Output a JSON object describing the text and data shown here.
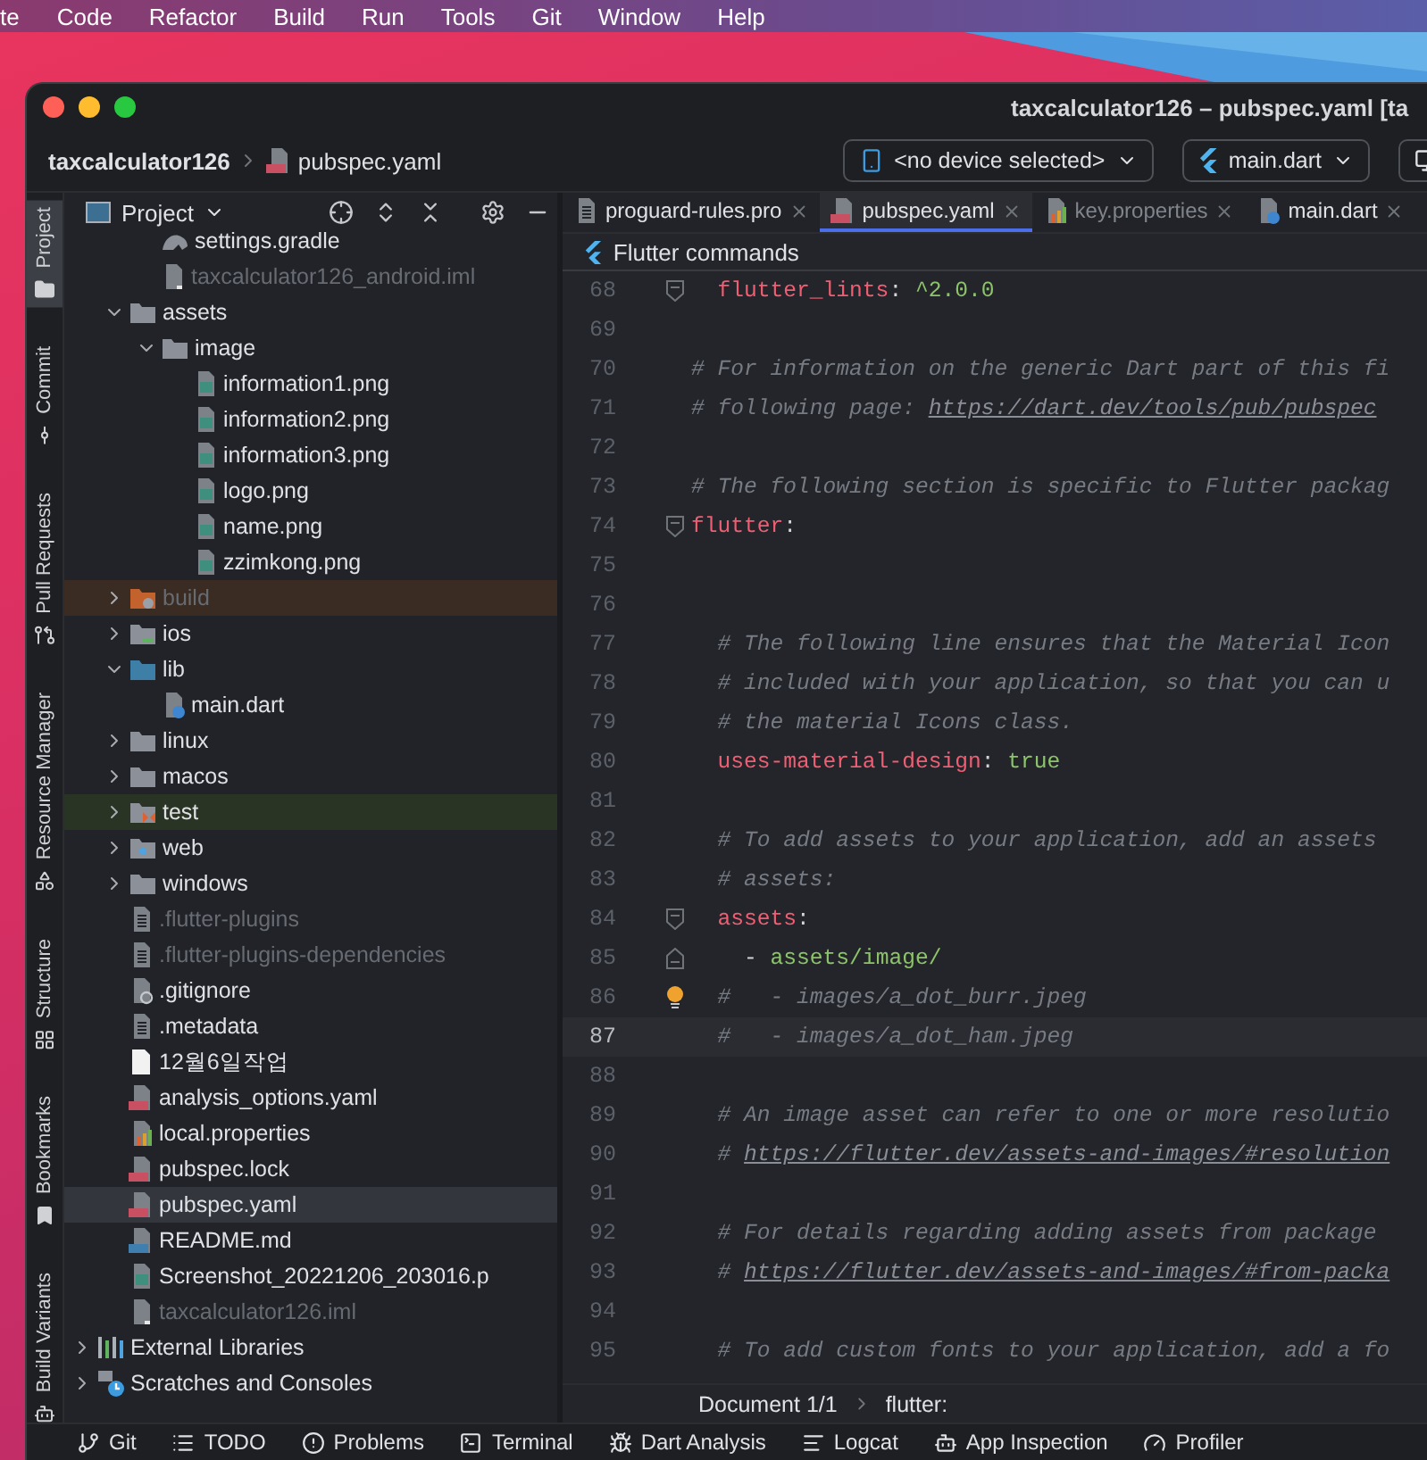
{
  "menu_bar": {
    "items": [
      "te",
      "Code",
      "Refactor",
      "Build",
      "Run",
      "Tools",
      "Git",
      "Window",
      "Help"
    ]
  },
  "window": {
    "title": "taxcalculator126 – pubspec.yaml [ta"
  },
  "breadcrumb": {
    "project": "taxcalculator126",
    "file": "pubspec.yaml"
  },
  "toolbar": {
    "device": "<no device selected>",
    "run_config": "main.dart"
  },
  "tool_strip": [
    {
      "label": "Project",
      "kind": "folder",
      "selected": true
    },
    {
      "label": "Commit",
      "kind": "commit",
      "selected": false
    },
    {
      "label": "Pull Requests",
      "kind": "pull",
      "selected": false
    },
    {
      "label": "Resource Manager",
      "kind": "resources",
      "selected": false
    },
    {
      "label": "Structure",
      "kind": "structure",
      "selected": false
    },
    {
      "label": "Bookmarks",
      "kind": "bookmark",
      "selected": false
    },
    {
      "label": "Build Variants",
      "kind": "android",
      "selected": false
    }
  ],
  "project_panel": {
    "title": "Project",
    "tree": [
      {
        "children": [
          {
            "children": [
              {
                "label": "settings.gradle",
                "kind": "gradle",
                "dimmed": false,
                "selected": false
              },
              {
                "label": "taxcalculator126_android.iml",
                "kind": "iml",
                "dimmed": true,
                "selected": false
              }
            ]
          },
          {
            "label": "assets",
            "kind": "folder",
            "expanded": true,
            "dimmed": false,
            "selected": false,
            "children": [
              {
                "label": "image",
                "kind": "folder",
                "expanded": true,
                "dimmed": false,
                "selected": false,
                "children": [
                  {
                    "label": "information1.png",
                    "kind": "png",
                    "dimmed": false,
                    "selected": false
                  },
                  {
                    "label": "information2.png",
                    "kind": "png",
                    "dimmed": false,
                    "selected": false
                  },
                  {
                    "label": "information3.png",
                    "kind": "png",
                    "dimmed": false,
                    "selected": false
                  },
                  {
                    "label": "logo.png",
                    "kind": "png",
                    "dimmed": false,
                    "selected": false
                  },
                  {
                    "label": "name.png",
                    "kind": "png",
                    "dimmed": false,
                    "selected": false
                  },
                  {
                    "label": "zzimkong.png",
                    "kind": "png",
                    "dimmed": false,
                    "selected": false
                  }
                ]
              }
            ]
          },
          {
            "label": "build",
            "kind": "folder-excluded",
            "expanded": false,
            "dimmed": true,
            "selected": false,
            "excluded": true
          },
          {
            "label": "ios",
            "kind": "folder-ios",
            "expanded": false,
            "dimmed": false,
            "selected": false
          },
          {
            "label": "lib",
            "kind": "folder-source",
            "expanded": true,
            "dimmed": false,
            "selected": false,
            "children": [
              {
                "label": "main.dart",
                "kind": "dart",
                "dimmed": false,
                "selected": false
              }
            ]
          },
          {
            "label": "linux",
            "kind": "folder",
            "expanded": false,
            "dimmed": false,
            "selected": false
          },
          {
            "label": "macos",
            "kind": "folder",
            "expanded": false,
            "dimmed": false,
            "selected": false
          },
          {
            "label": "test",
            "kind": "folder-test",
            "expanded": false,
            "dimmed": false,
            "selected": false,
            "test_root": true
          },
          {
            "label": "web",
            "kind": "folder-web",
            "expanded": false,
            "dimmed": false,
            "selected": false
          },
          {
            "label": "windows",
            "kind": "folder",
            "expanded": false,
            "dimmed": false,
            "selected": false
          },
          {
            "label": ".flutter-plugins",
            "kind": "text",
            "dimmed": true,
            "selected": false
          },
          {
            "label": ".flutter-plugins-dependencies",
            "kind": "text",
            "dimmed": true,
            "selected": false
          },
          {
            "label": ".gitignore",
            "kind": "gitignore",
            "dimmed": false,
            "selected": false
          },
          {
            "label": ".metadata",
            "kind": "text",
            "dimmed": false,
            "selected": false
          },
          {
            "label": "12월6일작업",
            "kind": "plain",
            "dimmed": false,
            "selected": false
          },
          {
            "label": "analysis_options.yaml",
            "kind": "yaml",
            "dimmed": false,
            "selected": false
          },
          {
            "label": "local.properties",
            "kind": "properties",
            "dimmed": false,
            "selected": false
          },
          {
            "label": "pubspec.lock",
            "kind": "yaml",
            "dimmed": false,
            "selected": false
          },
          {
            "label": "pubspec.yaml",
            "kind": "yaml",
            "dimmed": false,
            "selected": true
          },
          {
            "label": "README.md",
            "kind": "markdown",
            "dimmed": false,
            "selected": false
          },
          {
            "label": "Screenshot_20221206_203016.p",
            "kind": "png",
            "dimmed": false,
            "selected": false
          },
          {
            "label": "taxcalculator126.iml",
            "kind": "iml",
            "dimmed": true,
            "selected": false
          }
        ]
      },
      {
        "label": "External Libraries",
        "kind": "libraries",
        "expanded": false,
        "dimmed": false,
        "selected": false
      },
      {
        "label": "Scratches and Consoles",
        "kind": "scratches",
        "expanded": false,
        "dimmed": false,
        "selected": false
      }
    ]
  },
  "editor": {
    "tabs": [
      {
        "label": "proguard-rules.pro",
        "kind": "text",
        "selected": false,
        "dimmed": false
      },
      {
        "label": "pubspec.yaml",
        "kind": "yaml",
        "selected": true,
        "dimmed": false
      },
      {
        "label": "key.properties",
        "kind": "properties",
        "selected": false,
        "dimmed": true
      },
      {
        "label": "main.dart",
        "kind": "dart",
        "selected": false,
        "dimmed": false
      }
    ],
    "banner": "Flutter commands",
    "lines": [
      {
        "number": "68",
        "fold_start": true,
        "current": false,
        "bulb": false,
        "segments": [
          {
            "kind": "key",
            "text": "  flutter_lints"
          },
          {
            "kind": "punct",
            "text": ": "
          },
          {
            "kind": "string",
            "text": "^2.0.0"
          }
        ]
      },
      {
        "number": "69",
        "current": false,
        "bulb": false
      },
      {
        "number": "70",
        "current": false,
        "bulb": false,
        "segments": [
          {
            "kind": "comment",
            "text": "# For information on the generic Dart part of this fi"
          }
        ]
      },
      {
        "number": "71",
        "current": false,
        "bulb": false,
        "segments": [
          {
            "kind": "comment",
            "text": "# following page: "
          },
          {
            "kind": "link",
            "text": "https://dart.dev/tools/pub/pubspec"
          }
        ]
      },
      {
        "number": "72",
        "current": false,
        "bulb": false
      },
      {
        "number": "73",
        "current": false,
        "bulb": false,
        "segments": [
          {
            "kind": "comment",
            "text": "# The following section is specific to Flutter packag"
          }
        ]
      },
      {
        "number": "74",
        "fold_start": true,
        "current": false,
        "bulb": false,
        "segments": [
          {
            "kind": "key",
            "text": "flutter"
          },
          {
            "kind": "punct",
            "text": ":"
          }
        ]
      },
      {
        "number": "75",
        "current": false,
        "bulb": false
      },
      {
        "number": "76",
        "current": false,
        "bulb": false
      },
      {
        "number": "77",
        "current": false,
        "bulb": false,
        "segments": [
          {
            "kind": "comment",
            "text": "  # The following line ensures that the Material Icon"
          }
        ]
      },
      {
        "number": "78",
        "current": false,
        "bulb": false,
        "segments": [
          {
            "kind": "comment",
            "text": "  # included with your application, so that you can u"
          }
        ]
      },
      {
        "number": "79",
        "current": false,
        "bulb": false,
        "segments": [
          {
            "kind": "comment",
            "text": "  # the material Icons class."
          }
        ]
      },
      {
        "number": "80",
        "current": false,
        "bulb": false,
        "segments": [
          {
            "kind": "key",
            "text": "  uses-material-design"
          },
          {
            "kind": "punct",
            "text": ": "
          },
          {
            "kind": "string",
            "text": "true"
          }
        ]
      },
      {
        "number": "81",
        "current": false,
        "bulb": false
      },
      {
        "number": "82",
        "current": false,
        "bulb": false,
        "segments": [
          {
            "kind": "comment",
            "text": "  # To add assets to your application, add an assets"
          }
        ]
      },
      {
        "number": "83",
        "current": false,
        "bulb": false,
        "segments": [
          {
            "kind": "comment",
            "text": "  # assets:"
          }
        ]
      },
      {
        "number": "84",
        "fold_start": true,
        "current": false,
        "bulb": false,
        "segments": [
          {
            "kind": "key",
            "text": "  assets"
          },
          {
            "kind": "punct",
            "text": ":"
          }
        ]
      },
      {
        "number": "85",
        "fold_end": true,
        "current": false,
        "bulb": false,
        "segments": [
          {
            "kind": "punct",
            "text": "    - "
          },
          {
            "kind": "string",
            "text": "assets/image/"
          }
        ]
      },
      {
        "number": "86",
        "current": false,
        "bulb": true,
        "segments": [
          {
            "kind": "comment",
            "text": "  #   - images/a_dot_burr.jpeg"
          }
        ]
      },
      {
        "number": "87",
        "current": true,
        "bulb": false,
        "segments": [
          {
            "kind": "comment",
            "text": "  #   - images/a_dot_ham.jpeg"
          }
        ]
      },
      {
        "number": "88",
        "current": false,
        "bulb": false
      },
      {
        "number": "89",
        "current": false,
        "bulb": false,
        "segments": [
          {
            "kind": "comment",
            "text": "  # An image asset can refer to one or more resolutio"
          }
        ]
      },
      {
        "number": "90",
        "current": false,
        "bulb": false,
        "segments": [
          {
            "kind": "comment",
            "text": "  # "
          },
          {
            "kind": "link",
            "text": "https://flutter.dev/assets-and-images/#resolution"
          }
        ]
      },
      {
        "number": "91",
        "current": false,
        "bulb": false
      },
      {
        "number": "92",
        "current": false,
        "bulb": false,
        "segments": [
          {
            "kind": "comment",
            "text": "  # For details regarding adding assets from package"
          }
        ]
      },
      {
        "number": "93",
        "current": false,
        "bulb": false,
        "segments": [
          {
            "kind": "comment",
            "text": "  # "
          },
          {
            "kind": "link",
            "text": "https://flutter.dev/assets-and-images/#from-packa"
          }
        ]
      },
      {
        "number": "94",
        "current": false,
        "bulb": false
      },
      {
        "number": "95",
        "current": false,
        "bulb": false,
        "segments": [
          {
            "kind": "comment",
            "text": "  # To add custom fonts to your application, add a fo"
          }
        ]
      }
    ],
    "breadcrumbs": [
      "Document 1/1",
      "flutter:"
    ]
  },
  "bottom_tools": [
    {
      "label": "Git",
      "kind": "git"
    },
    {
      "label": "TODO",
      "kind": "list"
    },
    {
      "label": "Problems",
      "kind": "alert"
    },
    {
      "label": "Terminal",
      "kind": "terminal"
    },
    {
      "label": "Dart Analysis",
      "kind": "analysis"
    },
    {
      "label": "Logcat",
      "kind": "logcat"
    },
    {
      "label": "App Inspection",
      "kind": "inspect"
    },
    {
      "label": "Profiler",
      "kind": "gauge"
    }
  ]
}
